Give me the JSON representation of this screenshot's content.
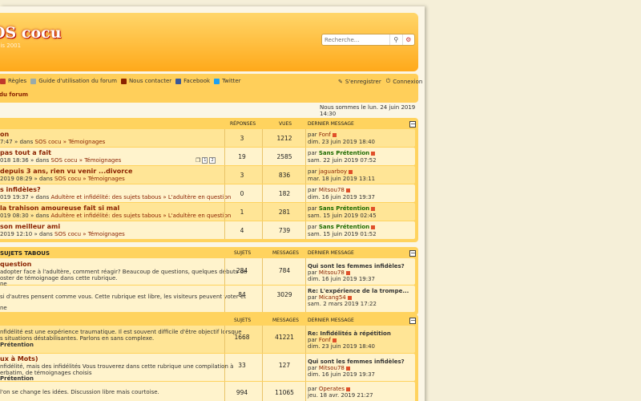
{
  "header": {
    "title": "OS cocu",
    "subtitle": "uis 2001",
    "search_placeholder": "Recherche..."
  },
  "nav": {
    "left": [
      "Règles",
      "Guide d'utilisation du forum",
      "Nous contacter",
      "Facebook",
      "Twitter"
    ],
    "right": [
      "S'enregistrer",
      "Connexion"
    ],
    "breadcrumb": "du forum"
  },
  "datetime": "Nous sommes le lun. 24 juin 2019 14:30",
  "colors": {
    "accent": "#8a2200",
    "header": "#ffa91a",
    "green_user": "#1e6b00"
  },
  "topics": {
    "headers": {
      "replies": "RÉPONSES",
      "views": "VUES",
      "last": "DERNIER MESSAGE"
    },
    "rows": [
      {
        "title": "on",
        "desc_pre": "7:47 » dans ",
        "desc_links": "SOS cocu » Témoignages",
        "n1": "3",
        "n2": "1212",
        "by": "Fonf",
        "date": "dim. 23 juin 2019 18:40"
      },
      {
        "title": "pas tout a fait",
        "desc_pre": "018 18:36 » dans ",
        "desc_links": "SOS cocu » Témoignages",
        "n1": "19",
        "n2": "2585",
        "by": "Sans Prétention",
        "date": "sam. 22 juin 2019 07:52",
        "pages": [
          "1",
          "2"
        ]
      },
      {
        "title": "depuis 3 ans, rien vu venir ...divorce",
        "desc_pre": "2019 08:29 » dans ",
        "desc_links": "SOS cocu » Témoignages",
        "n1": "3",
        "n2": "836",
        "by": "jaguarboy",
        "date": "mar. 18 juin 2019 13:11"
      },
      {
        "title": "s infidèles?",
        "desc_pre": "019 19:37 » dans ",
        "desc_links": "Adultère et infidélité: des sujets tabous » L'adultère en question",
        "n1": "0",
        "n2": "182",
        "by": "Mitsou78",
        "date": "dim. 16 juin 2019 19:37"
      },
      {
        "title": "la trahison amoureuse fait si mal",
        "desc_pre": "019 08:30 » dans ",
        "desc_links": "Adultère et infidélité: des sujets tabous » L'adultère en question",
        "n1": "1",
        "n2": "281",
        "by": "Sans Prétention",
        "date": "sam. 15 juin 2019 02:45"
      },
      {
        "title": "son meilleur ami",
        "desc_pre": "2019 12:10 » dans ",
        "desc_links": "SOS cocu » Témoignages",
        "n1": "4",
        "n2": "739",
        "by": "Sans Prétention",
        "date": "sam. 15 juin 2019 01:52"
      }
    ]
  },
  "section2": {
    "title": "SUJETS TABOUS",
    "headers": {
      "topics": "SUJETS",
      "messages": "MESSAGES",
      "last": "DERNIER MESSAGE"
    },
    "rows": [
      {
        "title": "question",
        "desc1": "adopter face à l'adultère, comment réagir? Beaucoup de questions, quelques débuts de",
        "desc2": "oster de témoignage dans cette rubrique.",
        "desc3": "ne",
        "n1": "284",
        "n2": "784",
        "lt": "Qui sont les femmes infidèles?",
        "by": "Mitsou78",
        "date": "dim. 16 juin 2019 19:37"
      },
      {
        "title": "",
        "desc1": "si d'autres pensent comme vous. Cette rubrique est libre, les visiteurs peuvent voter et",
        "desc2": "",
        "desc3": "ne",
        "n1": "84",
        "n2": "3029",
        "lt": "Re: L'expérience de la trompe...",
        "by": "Micang54",
        "date": "sam. 2 mars 2019 17:22"
      }
    ]
  },
  "section3": {
    "headers": {
      "topics": "SUJETS",
      "messages": "MESSAGES",
      "last": "DERNIER MESSAGE"
    },
    "rows": [
      {
        "desc1": "nfidélité est une expérience traumatique. Il est souvent difficile d'être objectif lorsque",
        "desc2": "s situations déstabilisantes. Parlons en sans complexe.",
        "desc3": "Prétention",
        "n1": "1668",
        "n2": "41221",
        "lt": "Re: Infidélités à répétition",
        "by": "Fonf",
        "date": "dim. 23 juin 2019 18:40"
      },
      {
        "title": "ux à Mots)",
        "desc1": "nfidélité, mais des infidélités Vous trouverez dans cette rubrique une compilation à",
        "desc2": "erbatim, de témoignages choisis",
        "desc3": "Prétention",
        "n1": "33",
        "n2": "127",
        "lt": "Qui sont les femmes infidèles?",
        "by": "Mitsou78",
        "date": "dim. 16 juin 2019 19:37"
      },
      {
        "desc1": "l'on se change les idées. Discussion libre mais courtoise.",
        "n1": "994",
        "n2": "11065",
        "by": "Operates",
        "date": "jeu. 18 avr. 2019 21:27"
      }
    ]
  }
}
